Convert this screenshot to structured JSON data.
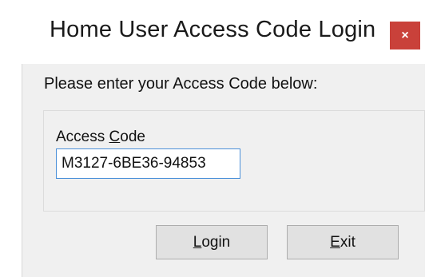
{
  "window": {
    "title": "Home User Access Code Login",
    "close_label": "×"
  },
  "dialog": {
    "prompt": "Please enter your Access Code below:",
    "field_label_key": "C",
    "field_label_pre": "Access ",
    "field_label_post": "ode",
    "access_code_value": "M3127-6BE36-94853"
  },
  "buttons": {
    "login_key": "L",
    "login_rest": "ogin",
    "exit_key": "E",
    "exit_rest": "xit"
  },
  "colors": {
    "close_button": "#c9413a",
    "input_border_focus": "#4a90d9",
    "client_background": "#f0f0f0"
  }
}
